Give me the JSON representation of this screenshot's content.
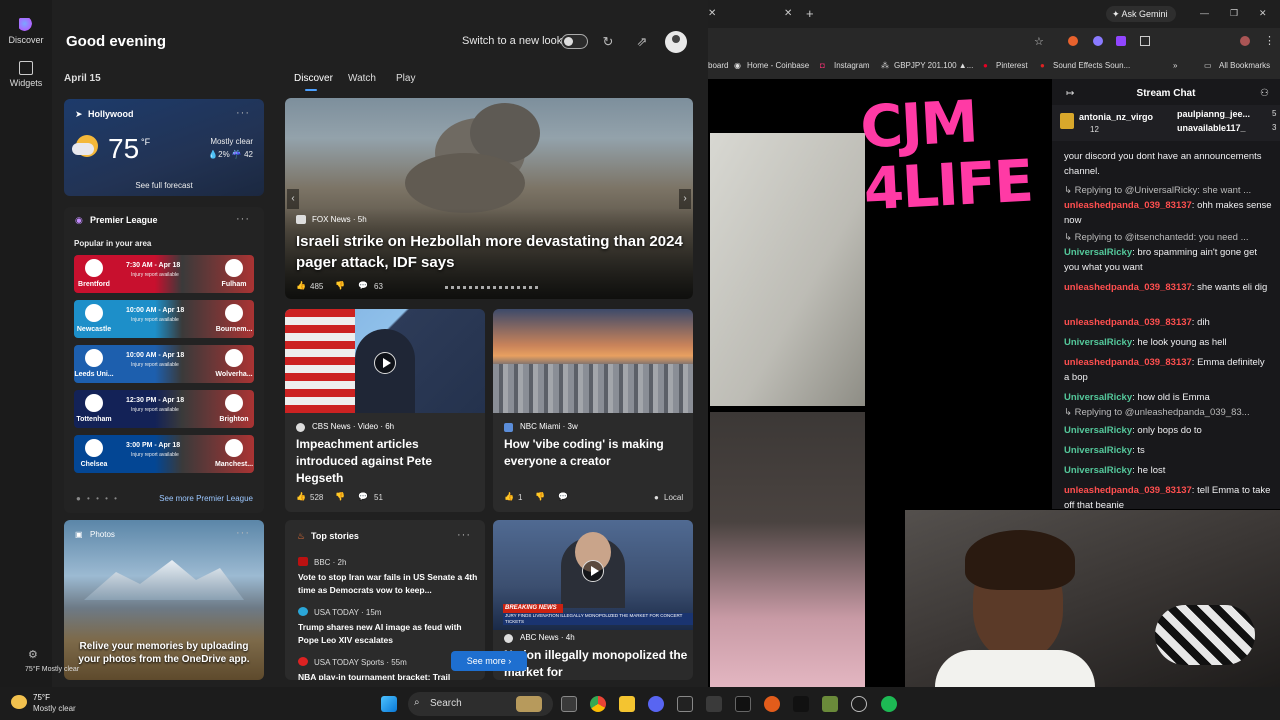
{
  "rail": {
    "discover": "Discover",
    "widgets": "Widgets"
  },
  "header": {
    "greeting": "Good evening",
    "switch_label": "Switch to a new look"
  },
  "date": "April 15",
  "tabs": [
    "Discover",
    "Watch",
    "Play"
  ],
  "weather": {
    "location": "Hollywood",
    "temp": "75",
    "unit": "°F",
    "condition": "Mostly clear",
    "stats": "💧2%  ☔ 42",
    "link": "See full forecast"
  },
  "premier": {
    "title": "Premier League",
    "subtitle": "Popular in your area",
    "more": "See more Premier League",
    "pager": "● • • • •",
    "matches": [
      {
        "home": "Brentford",
        "away": "Fulham",
        "kick": "7:30 AM - Apr 18",
        "inj": "Injury report available",
        "color": "#c8102e"
      },
      {
        "home": "Newcastle",
        "away": "Bournem...",
        "kick": "10:00 AM - Apr 18",
        "inj": "Injury report available",
        "color": "#1d8fc9"
      },
      {
        "home": "Leeds Uni...",
        "away": "Wolverha...",
        "kick": "10:00 AM - Apr 18",
        "inj": "Injury report available",
        "color": "#1d5fae"
      },
      {
        "home": "Tottenham",
        "away": "Brighton",
        "kick": "12:30 PM - Apr 18",
        "inj": "Injury report available",
        "color": "#132257"
      },
      {
        "home": "Chelsea",
        "away": "Manchest...",
        "kick": "3:00 PM - Apr 18",
        "inj": "Injury report available",
        "color": "#034694"
      }
    ]
  },
  "photos": {
    "title": "Photos",
    "text": "Relive your memories by uploading your photos from the OneDrive app."
  },
  "hero": {
    "source": "FOX News · 5h",
    "title": "Israeli strike on Hezbollah more devastating than 2024 pager attack, IDF says",
    "likes": "485",
    "comments": "63"
  },
  "news": [
    {
      "source": "CBS News · Video · 6h",
      "title": "Impeachment articles introduced against Pete Hegseth",
      "likes": "528",
      "comments": "51"
    },
    {
      "source": "NBC Miami · 3w",
      "title": "How 'vibe coding' is making everyone a creator",
      "likes": "1",
      "tag": "Local"
    }
  ],
  "top_stories": {
    "title": "Top stories",
    "items": [
      {
        "source": "BBC · 2h",
        "text": "Vote to stop Iran war fails in US Senate a 4th time as Democrats vow to keep..."
      },
      {
        "source": "USA TODAY · 15m",
        "text": "Trump shares new AI image as feud with Pope Leo XIV escalates"
      },
      {
        "source": "USA TODAY Sports · 55m",
        "text": "NBA play-in tournament bracket: Trail"
      }
    ],
    "see_more": "See more"
  },
  "tv": {
    "banner": "BREAKING NEWS",
    "ticker": "JURY FINDS LIVENATION ILLEGALLY MONOPOLIZED THE MARKET FOR CONCERT TICKETS",
    "source": "ABC News · 4h",
    "title": "Nation illegally monopolized the market for"
  },
  "panel_footer": {
    "weather": "75°F Mostly clear"
  },
  "browser": {
    "gemini": "Ask Gemini",
    "bookmarks": [
      "board",
      "Home - Coinbase",
      "Instagram",
      "GBPJPY 201.100 ▲...",
      "Pinterest",
      "Sound Effects Soun...",
      "All Bookmarks"
    ]
  },
  "graffiti": "CJM\n4LIFE",
  "chat": {
    "title": "Stream Chat",
    "gifters": [
      {
        "name": "antonia_nz_virgo",
        "count": "12"
      },
      {
        "name": "paulpianng_jee...",
        "count": "5"
      },
      {
        "name": "unavailable117_",
        "count": "3"
      }
    ],
    "messages": [
      {
        "type": "text",
        "text": "your discord you dont have an announcements channel."
      },
      {
        "type": "reply",
        "text": "Replying to @UniversalRicky: she want ..."
      },
      {
        "type": "msg",
        "user": "unleashedpanda_039_83137",
        "cls": "u1",
        "text": "ohh makes sense now"
      },
      {
        "type": "reply",
        "text": "Replying to @itsenchantedd: you need ..."
      },
      {
        "type": "msg",
        "user": "UniversalRicky",
        "cls": "u2",
        "text": "bro spamming ain't gone get you what you want"
      },
      {
        "type": "msg",
        "user": "unleashedpanda_039_83137",
        "cls": "u1",
        "text": "she wants eli dig"
      },
      {
        "type": "msg",
        "user": "unleashedpanda_039_83137",
        "cls": "u1",
        "text": "dih"
      },
      {
        "type": "msg",
        "user": "UniversalRicky",
        "cls": "u2",
        "text": "he look young as hell"
      },
      {
        "type": "msg",
        "user": "unleashedpanda_039_83137",
        "cls": "u1",
        "text": "Emma definitely a bop"
      },
      {
        "type": "msg",
        "user": "UniversalRicky",
        "cls": "u2",
        "text": "how old is Emma"
      },
      {
        "type": "reply",
        "text": "Replying to @unleashedpanda_039_83..."
      },
      {
        "type": "msg",
        "user": "UniversalRicky",
        "cls": "u2",
        "text": "only bops do to"
      },
      {
        "type": "msg",
        "user": "UniversalRicky",
        "cls": "u2",
        "text": "ts"
      },
      {
        "type": "msg",
        "user": "UniversalRicky",
        "cls": "u2",
        "text": "he lost"
      },
      {
        "type": "msg",
        "user": "unleashedpanda_039_83137",
        "cls": "u1",
        "text": "tell Emma to take off that beanie"
      }
    ]
  },
  "taskbar": {
    "temp": "75°F",
    "cond": "Mostly clear",
    "search": "Search"
  }
}
